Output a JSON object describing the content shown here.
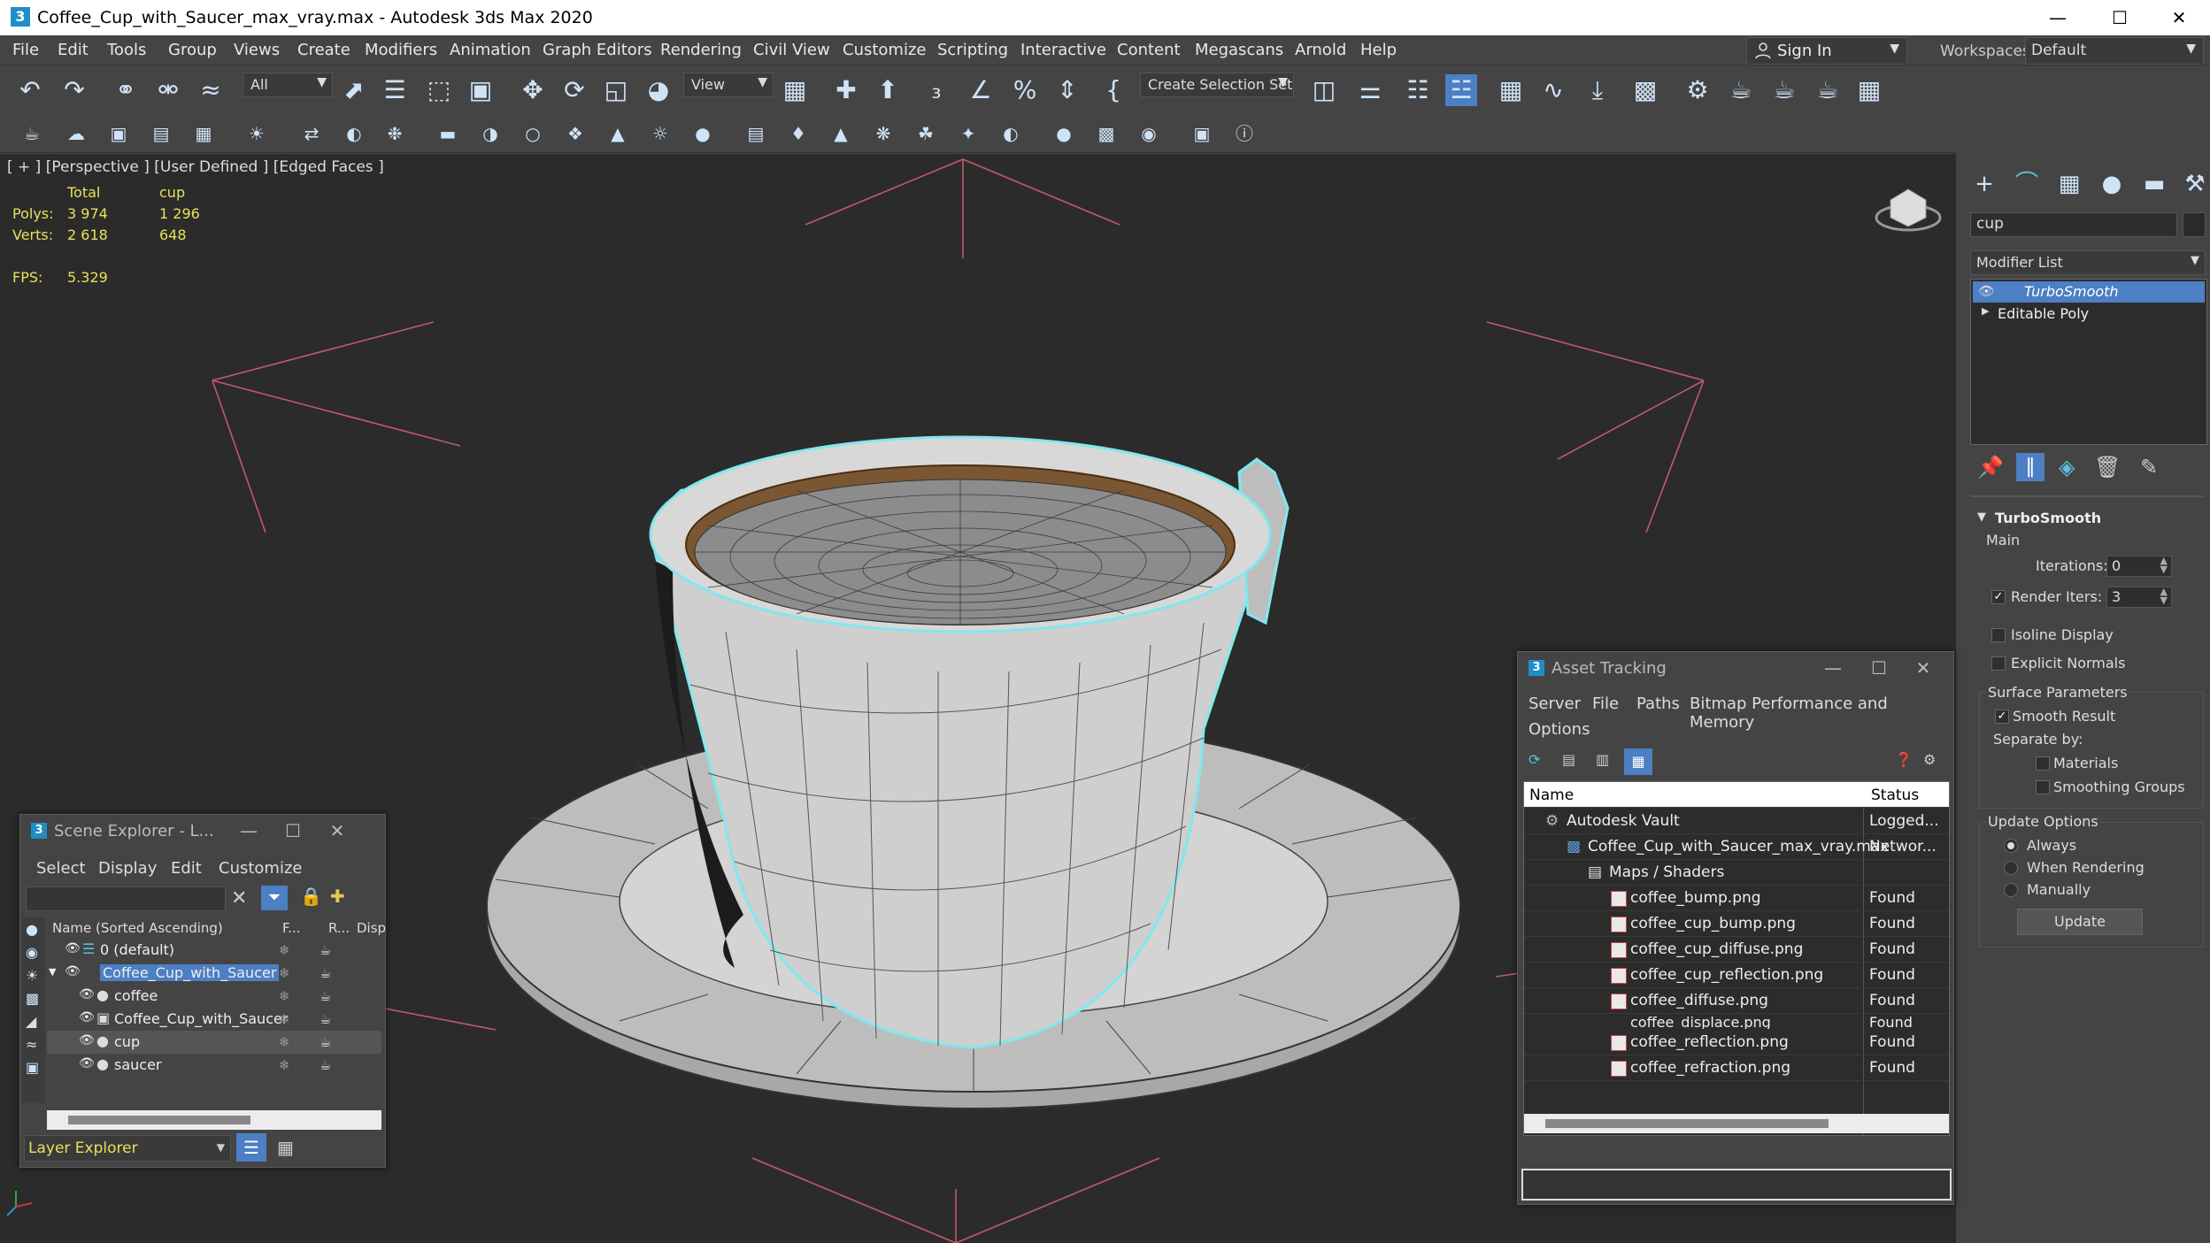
{
  "window": {
    "title": "Coffee_Cup_with_Saucer_max_vray.max - Autodesk 3ds Max 2020"
  },
  "menu": [
    "File",
    "Edit",
    "Tools",
    "Group",
    "Views",
    "Create",
    "Modifiers",
    "Animation",
    "Graph Editors",
    "Rendering",
    "Civil View",
    "Customize",
    "Scripting",
    "Interactive",
    "Content",
    "Megascans",
    "Arnold",
    "Help"
  ],
  "account": {
    "sign_in": "Sign In",
    "workspaces_label": "Workspaces:",
    "workspace": "Default"
  },
  "toolbar": {
    "selection_filter": "All",
    "ref_coord": "View",
    "selection_set": "Create Selection Set"
  },
  "viewport": {
    "label": "[ + ] [Perspective ] [User Defined ] [Edged Faces ]",
    "stats": {
      "col_total": "Total",
      "col_sel": "cup",
      "polys_label": "Polys:",
      "polys_total": "3 974",
      "polys_sel": "1 296",
      "verts_label": "Verts:",
      "verts_total": "2 618",
      "verts_sel": "648",
      "fps_label": "FPS:",
      "fps": "5.329"
    }
  },
  "command_panel": {
    "object_name": "cup",
    "modifier_list": "Modifier List",
    "stack": [
      "TurboSmooth",
      "Editable Poly"
    ],
    "turbosmooth": {
      "title": "TurboSmooth",
      "main": "Main",
      "iterations_label": "Iterations:",
      "iterations": "0",
      "render_iters_label": "Render Iters:",
      "render_iters": "3",
      "isoline": "Isoline Display",
      "explicit_normals": "Explicit Normals",
      "surface_params": "Surface Parameters",
      "smooth_result": "Smooth Result",
      "separate_by": "Separate by:",
      "materials": "Materials",
      "smoothing_groups": "Smoothing Groups",
      "update_options": "Update Options",
      "always": "Always",
      "when_rendering": "When Rendering",
      "manually": "Manually",
      "update_btn": "Update"
    }
  },
  "scene_explorer": {
    "title": "Scene Explorer - L...",
    "menu": [
      "Select",
      "Display",
      "Edit",
      "Customize"
    ],
    "col_name": "Name (Sorted Ascending)",
    "col_f": "F...",
    "col_r": "R...",
    "col_disp": "Disp",
    "rows": [
      {
        "label": "0 (default)"
      },
      {
        "label": "Coffee_Cup_with_Saucer"
      },
      {
        "label": "coffee"
      },
      {
        "label": "Coffee_Cup_with_Saucer"
      },
      {
        "label": "cup"
      },
      {
        "label": "saucer"
      }
    ],
    "footer": "Layer Explorer"
  },
  "asset_tracking": {
    "title": "Asset Tracking",
    "menu": [
      "Server",
      "File",
      "Paths",
      "Bitmap Performance and Memory",
      "Options"
    ],
    "col_name": "Name",
    "col_status": "Status",
    "rows": [
      {
        "name": "Autodesk Vault",
        "status": "Logged..."
      },
      {
        "name": "Coffee_Cup_with_Saucer_max_vray.max",
        "status": "Networ..."
      },
      {
        "name": "Maps / Shaders",
        "status": ""
      },
      {
        "name": "coffee_bump.png",
        "status": "Found"
      },
      {
        "name": "coffee_cup_bump.png",
        "status": "Found"
      },
      {
        "name": "coffee_cup_diffuse.png",
        "status": "Found"
      },
      {
        "name": "coffee_cup_reflection.png",
        "status": "Found"
      },
      {
        "name": "coffee_diffuse.png",
        "status": "Found"
      },
      {
        "name": "coffee_displace.png",
        "status": "Found"
      },
      {
        "name": "coffee_reflection.png",
        "status": "Found"
      },
      {
        "name": "coffee_refraction.png",
        "status": "Found"
      }
    ]
  },
  "colors": {
    "accent": "#5b9bd5",
    "selection": "#4c7fc3",
    "viewport_bg": "#2b2b2b",
    "stats": "#e8e25a",
    "selected_outline": "#7fe8f0"
  }
}
